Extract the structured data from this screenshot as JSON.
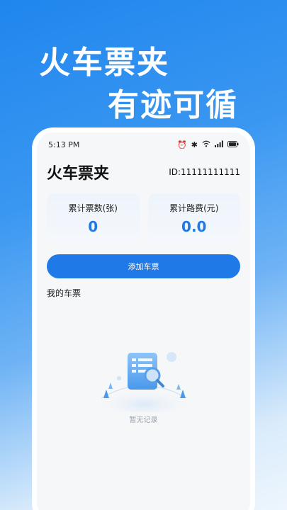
{
  "hero": {
    "line1": "火车票夹",
    "line2": "有迹可循"
  },
  "status_bar": {
    "time": "5:13 PM"
  },
  "header": {
    "title": "火车票夹",
    "user_id": "ID:11111111111"
  },
  "stats": [
    {
      "label": "累计票数(张)",
      "value": "0"
    },
    {
      "label": "累计路费(元)",
      "value": "0.0"
    }
  ],
  "add_button_label": "添加车票",
  "section_title": "我的车票",
  "empty_state_text": "暂无记录",
  "colors": {
    "accent": "#1f7ae8",
    "background_gradient_start": "#1f86ee"
  }
}
